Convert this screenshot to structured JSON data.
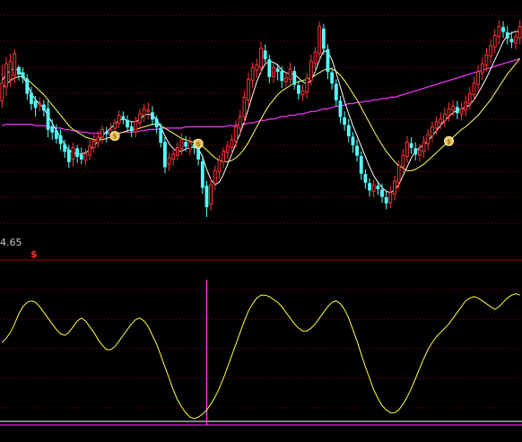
{
  "axis": {
    "price_label": "4.65",
    "dollar_marker": "$"
  },
  "colors": {
    "background": "#000000",
    "grid": "#8b0000",
    "candle_up": "#ff3333",
    "candle_down": "#55ffff",
    "ma_short": "#ffffff",
    "ma_mid": "#ffff66",
    "ma_long": "#ff33ff",
    "oscillator": "#ffff44",
    "signal_line": "#ff33ff"
  },
  "chart_data": [
    {
      "type": "candlestick",
      "panel": "price",
      "candles": [
        [
          182,
          196,
          177,
          210
        ],
        [
          193,
          211,
          186,
          216
        ],
        [
          199,
          213,
          193,
          219
        ],
        [
          202,
          219,
          196,
          222
        ],
        [
          208,
          203,
          198,
          210
        ],
        [
          204,
          200,
          196,
          208
        ],
        [
          199,
          188,
          183,
          203
        ],
        [
          188,
          180,
          175,
          193
        ],
        [
          182,
          177,
          170,
          186
        ],
        [
          179,
          180,
          174,
          185
        ],
        [
          179,
          175,
          170,
          183
        ],
        [
          176,
          160,
          154,
          182
        ],
        [
          162,
          158,
          152,
          168
        ],
        [
          159,
          153,
          149,
          164
        ],
        [
          155,
          149,
          144,
          160
        ],
        [
          148,
          143,
          138,
          152
        ],
        [
          144,
          135,
          130,
          148
        ],
        [
          137,
          146,
          131,
          150
        ],
        [
          145,
          139,
          134,
          148
        ],
        [
          140,
          137,
          133,
          146
        ],
        [
          136,
          141,
          132,
          145
        ],
        [
          140,
          147,
          136,
          152
        ],
        [
          146,
          151,
          142,
          156
        ],
        [
          150,
          154,
          146,
          159
        ],
        [
          154,
          160,
          149,
          163
        ],
        [
          158,
          157,
          150,
          162
        ],
        [
          156,
          160,
          152,
          165
        ],
        [
          161,
          165,
          157,
          168
        ],
        [
          165,
          171,
          161,
          175
        ],
        [
          170,
          168,
          164,
          174
        ],
        [
          167,
          162,
          158,
          171
        ],
        [
          162,
          159,
          154,
          166
        ],
        [
          158,
          166,
          154,
          170
        ],
        [
          165,
          172,
          161,
          176
        ],
        [
          171,
          176,
          166,
          180
        ],
        [
          174,
          175,
          168,
          181
        ],
        [
          173,
          168,
          163,
          178
        ],
        [
          168,
          162,
          157,
          171
        ],
        [
          161,
          150,
          146,
          165
        ],
        [
          150,
          131,
          126,
          154
        ],
        [
          133,
          138,
          128,
          142
        ],
        [
          137,
          141,
          132,
          145
        ],
        [
          140,
          146,
          136,
          150
        ],
        [
          145,
          152,
          140,
          157
        ],
        [
          150,
          147,
          143,
          155
        ],
        [
          145,
          150,
          140,
          154
        ],
        [
          148,
          146,
          141,
          152
        ],
        [
          145,
          137,
          132,
          149
        ],
        [
          135,
          115,
          110,
          140
        ],
        [
          116,
          100,
          92,
          120
        ],
        [
          102,
          117,
          97,
          122
        ],
        [
          118,
          128,
          113,
          132
        ],
        [
          127,
          136,
          122,
          140
        ],
        [
          135,
          143,
          130,
          146
        ],
        [
          142,
          147,
          137,
          151
        ],
        [
          146,
          152,
          141,
          156
        ],
        [
          151,
          162,
          146,
          167
        ],
        [
          161,
          170,
          155,
          175
        ],
        [
          170,
          185,
          165,
          190
        ],
        [
          183,
          199,
          178,
          204
        ],
        [
          198,
          208,
          192,
          212
        ],
        [
          206,
          210,
          200,
          215
        ],
        [
          208,
          223,
          203,
          228
        ],
        [
          221,
          215,
          212,
          226
        ],
        [
          214,
          201,
          196,
          218
        ],
        [
          201,
          208,
          196,
          212
        ],
        [
          207,
          205,
          198,
          211
        ],
        [
          205,
          198,
          192,
          209
        ],
        [
          197,
          200,
          193,
          204
        ],
        [
          199,
          207,
          195,
          212
        ],
        [
          205,
          195,
          191,
          209
        ],
        [
          194,
          188,
          183,
          198
        ],
        [
          187,
          190,
          182,
          195
        ],
        [
          189,
          200,
          184,
          204
        ],
        [
          198,
          213,
          194,
          218
        ],
        [
          211,
          220,
          205,
          224
        ],
        [
          219,
          240,
          214,
          244
        ],
        [
          238,
          223,
          218,
          242
        ],
        [
          222,
          205,
          199,
          226
        ],
        [
          204,
          196,
          191,
          208
        ],
        [
          195,
          183,
          178,
          199
        ],
        [
          182,
          170,
          165,
          186
        ],
        [
          169,
          164,
          159,
          174
        ],
        [
          163,
          155,
          150,
          168
        ],
        [
          154,
          148,
          142,
          158
        ],
        [
          147,
          140,
          135,
          152
        ],
        [
          139,
          126,
          121,
          143
        ],
        [
          125,
          119,
          114,
          129
        ],
        [
          118,
          113,
          108,
          122
        ],
        [
          112,
          117,
          107,
          121
        ],
        [
          116,
          114,
          109,
          120
        ],
        [
          113,
          108,
          103,
          118
        ],
        [
          107,
          103,
          98,
          112
        ],
        [
          103,
          111,
          99,
          116
        ],
        [
          110,
          120,
          105,
          124
        ],
        [
          119,
          132,
          114,
          136
        ],
        [
          131,
          140,
          126,
          145
        ],
        [
          139,
          150,
          134,
          155
        ],
        [
          149,
          146,
          141,
          154
        ],
        [
          145,
          141,
          136,
          150
        ],
        [
          140,
          144,
          135,
          149
        ],
        [
          143,
          150,
          138,
          155
        ],
        [
          149,
          156,
          144,
          160
        ],
        [
          155,
          162,
          150,
          166
        ],
        [
          161,
          166,
          156,
          170
        ],
        [
          165,
          168,
          160,
          173
        ],
        [
          167,
          172,
          162,
          177
        ],
        [
          171,
          176,
          166,
          181
        ],
        [
          175,
          178,
          170,
          183
        ],
        [
          177,
          173,
          168,
          182
        ],
        [
          172,
          176,
          167,
          181
        ],
        [
          175,
          181,
          170,
          186
        ],
        [
          180,
          188,
          175,
          193
        ],
        [
          187,
          196,
          182,
          201
        ],
        [
          195,
          205,
          190,
          210
        ],
        [
          204,
          211,
          198,
          216
        ],
        [
          210,
          218,
          205,
          223
        ],
        [
          217,
          225,
          211,
          230
        ],
        [
          224,
          233,
          219,
          238
        ],
        [
          232,
          240,
          226,
          245
        ],
        [
          239,
          236,
          231,
          244
        ],
        [
          235,
          231,
          226,
          240
        ],
        [
          230,
          228,
          223,
          236
        ],
        [
          227,
          232,
          222,
          237
        ],
        [
          231,
          240,
          226,
          245
        ]
      ],
      "ma_short": [
        198,
        203,
        206,
        207,
        206,
        201,
        195,
        188,
        183,
        180,
        176,
        171,
        165,
        159,
        154,
        148,
        144,
        142,
        141,
        141,
        142,
        144,
        147,
        151,
        155,
        158,
        161,
        164,
        167,
        168,
        167,
        166,
        166,
        168,
        171,
        172,
        171,
        168,
        162,
        155,
        149,
        145,
        143,
        143,
        145,
        146,
        146,
        145,
        139,
        129,
        121,
        117,
        119,
        125,
        133,
        141,
        149,
        157,
        166,
        176,
        187,
        197,
        205,
        211,
        213,
        212,
        210,
        206,
        204,
        203,
        203,
        200,
        197,
        195,
        198,
        205,
        214,
        221,
        220,
        214,
        204,
        193,
        182,
        172,
        163,
        155,
        147,
        139,
        131,
        124,
        119,
        115,
        112,
        111,
        113,
        117,
        124,
        131,
        138,
        143,
        146,
        148,
        151,
        155,
        159,
        163,
        167,
        170,
        173,
        175,
        176,
        177,
        179,
        183,
        188,
        194,
        200,
        207,
        214,
        221,
        228,
        233,
        235,
        236,
        236
      ],
      "ma_mid": [
        192,
        195,
        198,
        200,
        201,
        201,
        199,
        196,
        193,
        190,
        187,
        183,
        179,
        175,
        171,
        167,
        163,
        160,
        158,
        156,
        154,
        153,
        152,
        152,
        152,
        153,
        154,
        155,
        157,
        158,
        159,
        160,
        160,
        161,
        162,
        163,
        164,
        164,
        163,
        161,
        159,
        157,
        155,
        153,
        152,
        151,
        150,
        149,
        147,
        144,
        141,
        138,
        136,
        135,
        135,
        136,
        138,
        141,
        145,
        150,
        156,
        162,
        168,
        174,
        179,
        183,
        187,
        190,
        192,
        194,
        196,
        197,
        198,
        199,
        200,
        202,
        204,
        206,
        207,
        207,
        205,
        202,
        198,
        193,
        188,
        183,
        177,
        171,
        165,
        159,
        153,
        148,
        143,
        139,
        135,
        132,
        130,
        128,
        128,
        129,
        131,
        133,
        136,
        139,
        142,
        145,
        148,
        151,
        154,
        157,
        160,
        162,
        165,
        168,
        171,
        175,
        179,
        183,
        188,
        193,
        198,
        203,
        207,
        211,
        215
      ],
      "ma_long": [
        163,
        164,
        164,
        164,
        164,
        164,
        164,
        164,
        163,
        163,
        163,
        162,
        162,
        161,
        161,
        160,
        160,
        159,
        159,
        158,
        158,
        157,
        157,
        157,
        157,
        157,
        157,
        157,
        157,
        158,
        158,
        158,
        158,
        159,
        159,
        160,
        160,
        160,
        161,
        161,
        161,
        161,
        161,
        161,
        162,
        162,
        162,
        162,
        162,
        162,
        162,
        162,
        162,
        162,
        163,
        163,
        163,
        164,
        164,
        165,
        165,
        166,
        167,
        167,
        168,
        168,
        169,
        170,
        170,
        171,
        171,
        172,
        172,
        173,
        174,
        174,
        175,
        176,
        176,
        177,
        178,
        178,
        179,
        180,
        180,
        181,
        181,
        182,
        182,
        183,
        183,
        184,
        184,
        185,
        185,
        186,
        187,
        188,
        189,
        190,
        191,
        192,
        193,
        194,
        195,
        196,
        197,
        198,
        199,
        200,
        201,
        202,
        203,
        204,
        205,
        206,
        207,
        208,
        209,
        210,
        211,
        212,
        213,
        214,
        215
      ],
      "buy_markers": [
        27,
        47,
        107
      ]
    },
    {
      "type": "line",
      "panel": "oscillator",
      "osc": [
        55,
        58,
        62,
        68,
        75,
        80,
        83,
        84,
        83,
        80,
        76,
        72,
        68,
        64,
        61,
        60,
        62,
        66,
        70,
        72,
        70,
        66,
        62,
        57,
        53,
        50,
        50,
        52,
        56,
        60,
        64,
        68,
        71,
        72,
        70,
        66,
        60,
        54,
        46,
        38,
        30,
        22,
        15,
        10,
        6,
        3,
        2,
        3,
        5,
        8,
        12,
        17,
        23,
        30,
        38,
        46,
        54,
        62,
        70,
        77,
        82,
        86,
        88,
        88,
        87,
        85,
        83,
        80,
        76,
        72,
        68,
        65,
        63,
        63,
        65,
        68,
        72,
        76,
        80,
        83,
        84,
        82,
        78,
        72,
        64,
        56,
        47,
        38,
        30,
        22,
        16,
        11,
        8,
        6,
        6,
        8,
        12,
        17,
        23,
        30,
        37,
        44,
        50,
        55,
        59,
        62,
        65,
        68,
        72,
        76,
        80,
        84,
        86,
        87,
        86,
        84,
        82,
        80,
        78,
        80,
        83,
        86,
        88,
        89,
        88
      ],
      "signal_spike_index": 49
    }
  ]
}
